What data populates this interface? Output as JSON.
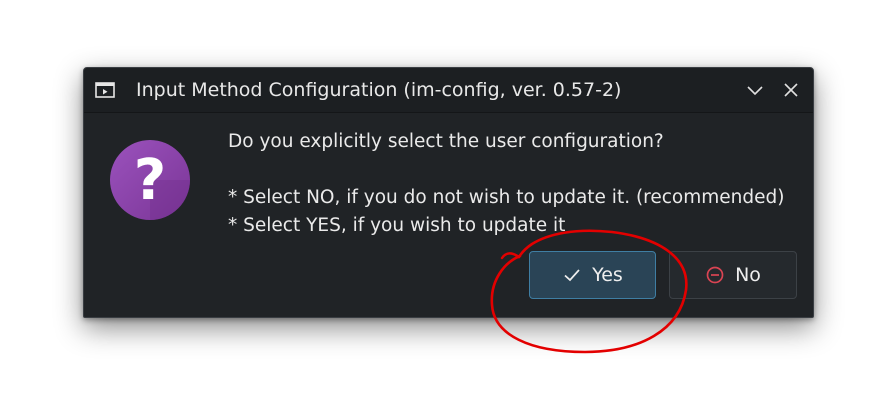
{
  "window": {
    "title": "Input Method Configuration (im-config, ver. 0.57-2)",
    "app_icon": "window-app-icon",
    "controls": [
      {
        "name": "minimize",
        "icon": "chevron-down-icon"
      },
      {
        "name": "close",
        "icon": "close-icon"
      }
    ]
  },
  "dialog": {
    "icon": "question-icon",
    "icon_color": "#8e44ad",
    "question": "Do you explicitly select the user configuration?",
    "lines": [
      "* Select NO, if you do not wish to update it. (recommended)",
      "* Select YES, if you wish to update it"
    ]
  },
  "buttons": {
    "yes": {
      "label": "Yes",
      "icon": "checkmark-icon",
      "focused": true
    },
    "no": {
      "label": "No",
      "icon": "no-entry-icon",
      "icon_color": "#da4453"
    }
  },
  "annotation": {
    "shape": "hand-drawn-circle",
    "color": "#e30000",
    "target": "yes-button"
  }
}
